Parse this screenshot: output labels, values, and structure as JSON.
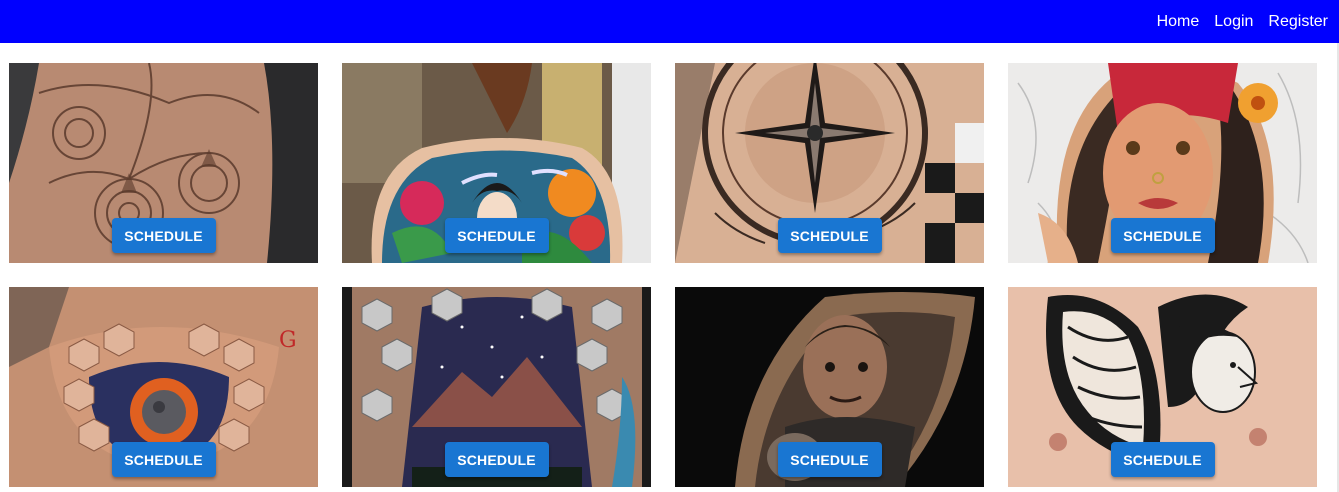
{
  "nav": {
    "home_label": "Home",
    "login_label": "Login",
    "register_label": "Register"
  },
  "colors": {
    "navbar": "#0000ff",
    "button": "#1976d2"
  },
  "cards": [
    {
      "button_label": "SCHEDULE",
      "image": "dotwork mandala back tattoo"
    },
    {
      "button_label": "SCHEDULE",
      "image": "colorful japanese geisha back tattoo"
    },
    {
      "button_label": "SCHEDULE",
      "image": "compass arm tattoo"
    },
    {
      "button_label": "SCHEDULE",
      "image": "neo-traditional woman portrait tattoo"
    },
    {
      "button_label": "SCHEDULE",
      "image": "3d hexagon chest tattoo with planet"
    },
    {
      "button_label": "SCHEDULE",
      "image": "3d hexagon back tattoo with mountain"
    },
    {
      "button_label": "SCHEDULE",
      "image": "realistic portrait arm tattoo"
    },
    {
      "button_label": "SCHEDULE",
      "image": "butterfly woman chest tattoo"
    }
  ]
}
